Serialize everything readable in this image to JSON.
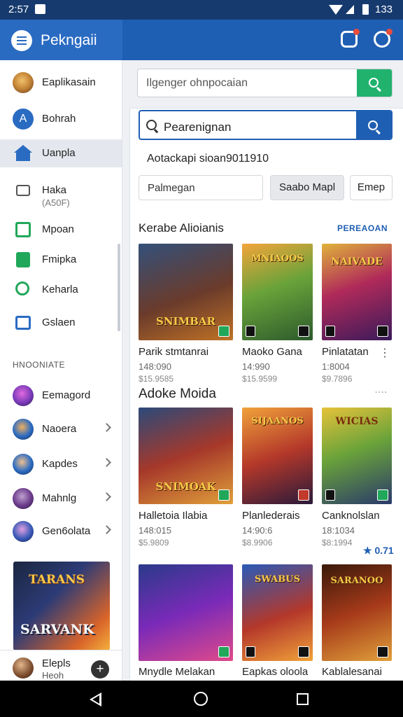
{
  "status_bar": {
    "time": "2:57",
    "battery": "133"
  },
  "app_bar": {
    "title": "Pekngaii"
  },
  "sidebar": {
    "items": [
      {
        "label": "Eaplikasain",
        "sub": "",
        "icon": "avatar-icon",
        "color": "#c98a3a",
        "chevron": false
      },
      {
        "label": "Bohrah",
        "sub": "",
        "icon": "app-store-icon",
        "color": "#2a6bc2",
        "chevron": false
      },
      {
        "label": "Uanpla",
        "sub": "",
        "icon": "home-icon",
        "color": "#2a6bc2",
        "chevron": false
      },
      {
        "label": "Haka",
        "sub": "(A50F)",
        "icon": "briefcase-icon",
        "color": "#555555",
        "chevron": false
      },
      {
        "label": "Mpoan",
        "sub": "",
        "icon": "check-box-icon",
        "color": "#21a75a",
        "chevron": false
      },
      {
        "label": "Fmipka",
        "sub": "",
        "icon": "bookmark-icon",
        "color": "#21a75a",
        "chevron": false
      },
      {
        "label": "Keharla",
        "sub": "",
        "icon": "search-icon",
        "color": "#21a75a",
        "chevron": false
      },
      {
        "label": "Gslaen",
        "sub": "",
        "icon": "tray-icon",
        "color": "#2a6bc2",
        "chevron": false
      }
    ],
    "section_label": "HNOONIATE",
    "games": [
      {
        "label": "Eemagord",
        "color": "#7a3ab8"
      },
      {
        "label": "Naoera",
        "color": "#2a6bc2"
      },
      {
        "label": "Kapdes",
        "color": "#2a6bc2"
      },
      {
        "label": "Mahnlg",
        "color": "#6a3a8a"
      },
      {
        "label": "Gen6olata",
        "color": "#3a5ab8"
      }
    ],
    "promo": {
      "line1": "TARANS",
      "line2": "SARVANK"
    },
    "footer": {
      "label": "Elepls",
      "sub": "Heoh"
    }
  },
  "search_top": {
    "placeholder": "Ilgenger ohnpocaian"
  },
  "search_main": {
    "placeholder": "Pearenignan"
  },
  "result_info": "Aotackapi sioan9011910",
  "filters": {
    "input_label": "Palmegan",
    "chips": [
      "Saabo Mapl",
      "Emep"
    ]
  },
  "sections": [
    {
      "title": "Kerabe Alioianis",
      "link": "PEREAOAN",
      "cards": [
        {
          "caption": "SNIMBAR",
          "title": "Parik stmtanrai",
          "meta1": "148:090",
          "meta2": "$15.9585",
          "bg": "linear-gradient(160deg,#33507a 0%,#6a3b2b 55%,#c07226 100%)"
        },
        {
          "caption": "MNIAOOS",
          "title": "Maoko Gana",
          "meta1": "14:990",
          "meta2": "$15.9599",
          "bg": "linear-gradient(160deg,#f3a43a 0%,#6aa33a 45%,#2c5a2c 100%)"
        },
        {
          "caption": "NAIVADE",
          "title": "Pinlatatan",
          "meta1": "1:8004",
          "meta2": "$9.7896",
          "bg": "linear-gradient(160deg,#e0b23a 0%,#b02a5a 45%,#3a1a5a 100%)"
        }
      ]
    },
    {
      "title": "Adoke Moida",
      "link": "",
      "cards": [
        {
          "caption": "SNIMOAK",
          "title": "Halletoia Ilabia",
          "meta1": "148:015",
          "meta2": "$5.9809",
          "bg": "linear-gradient(160deg,#2b4a7a 0%,#a6382a 50%,#e0a03a 100%)"
        },
        {
          "caption": "SIJAANOS",
          "title": "Planlederais",
          "meta1": "14:90:6",
          "meta2": "$8.9906",
          "bg": "linear-gradient(160deg,#f0a23a 0%,#b4382a 50%,#2a1a3a 100%)"
        },
        {
          "caption": "WICIAS",
          "title": "Canknolslan",
          "meta1": "18:1034",
          "meta2": "$8:1994",
          "bg": "linear-gradient(160deg,#e6c23a 0%,#6aa33a 45%,#2a3a6a 100%)"
        }
      ],
      "extra": "0.71"
    },
    {
      "title": "",
      "link": "",
      "cards": [
        {
          "caption": "",
          "title": "Mnydle Melakan",
          "meta1": "",
          "meta2": "",
          "bg": "linear-gradient(160deg,#2a3a8a 0%,#7a2ab8 50%,#e04a8a 100%)"
        },
        {
          "caption": "SWABUS",
          "title": "Eapkas oloola",
          "meta1": "",
          "meta2": "",
          "bg": "linear-gradient(160deg,#2a5ab8 0%,#b4382a 55%,#f0a23a 100%)"
        },
        {
          "caption": "SARANOO",
          "title": "Kablalesanai",
          "meta1": "",
          "meta2": "",
          "bg": "linear-gradient(160deg,#3a1a0a 0%,#a63a1a 50%,#e0a03a 100%)"
        }
      ]
    }
  ]
}
